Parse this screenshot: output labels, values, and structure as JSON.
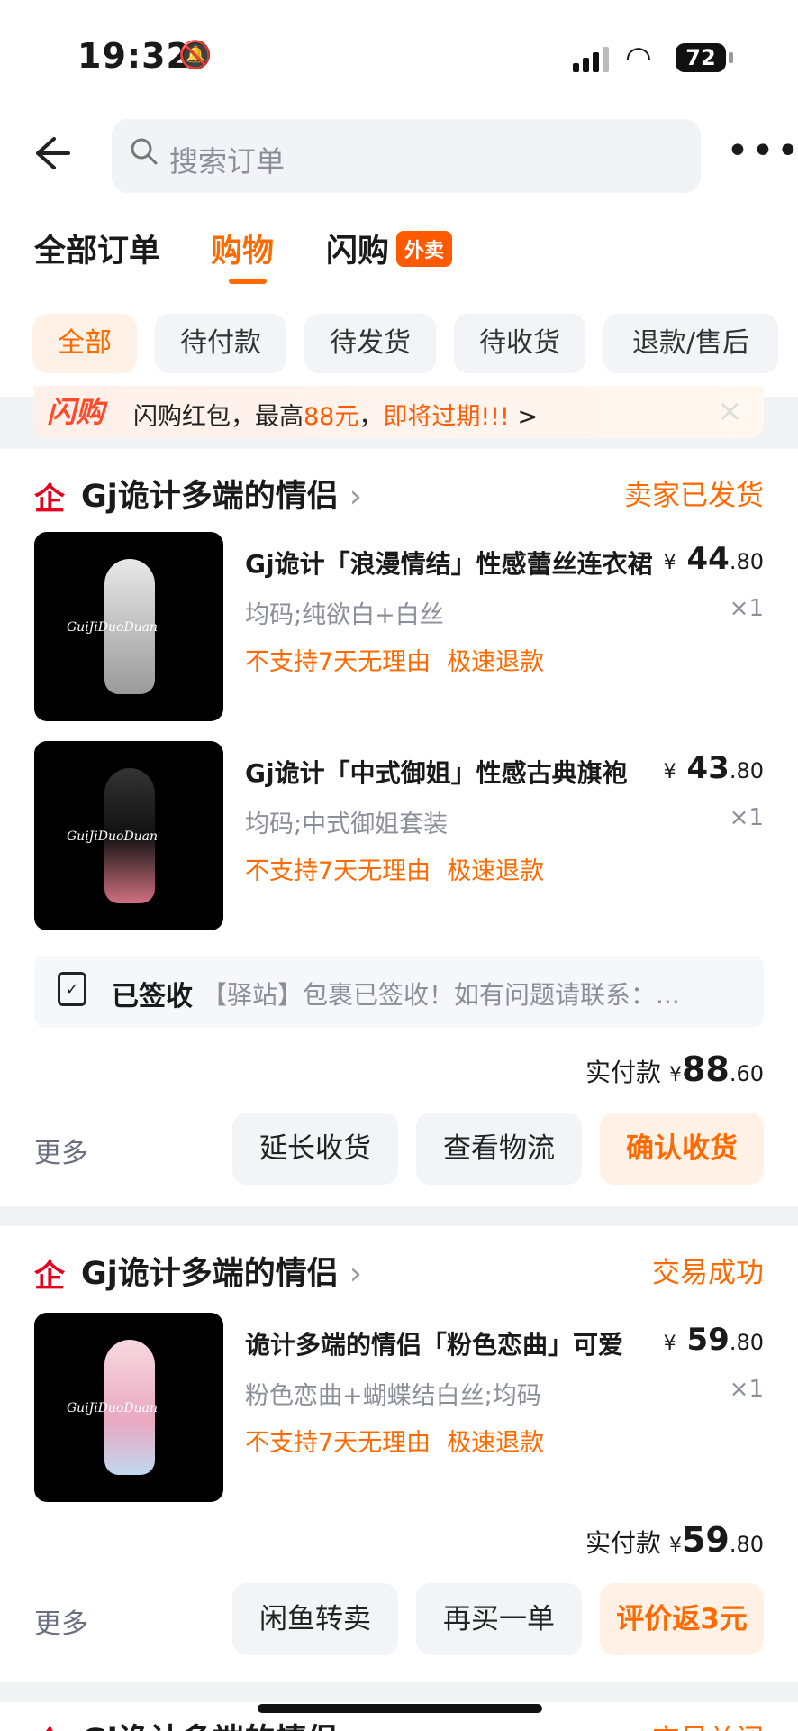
{
  "status_bar": {
    "time": "19:32",
    "battery": "72"
  },
  "header": {
    "search_placeholder": "搜索订单",
    "more": "•••"
  },
  "tabs": [
    {
      "label": "全部订单"
    },
    {
      "label": "购物"
    },
    {
      "label": "闪购",
      "tag": "外卖"
    }
  ],
  "filters": [
    "全部",
    "待付款",
    "待发货",
    "待收货",
    "退款/售后"
  ],
  "promo": {
    "logo": "闪购",
    "pre": "闪购红包，最高",
    "amount": "88元",
    "comma": "，",
    "expire": "即将过期!!!",
    "arrow": ">",
    "close": "×"
  },
  "orders": [
    {
      "shop": "Gj诡计多端的情侣",
      "status": "卖家已发货",
      "items": [
        {
          "title": "Gj诡计「浪漫情结」性感蕾丝连衣裙",
          "price_int": "44",
          "price_dec": ".80",
          "spec": "均码;纯欲白+白丝",
          "qty": "×1",
          "policy1": "不支持7天无理由",
          "policy2": "极速退款"
        },
        {
          "title": "Gj诡计「中式御姐」性感古典旗袍",
          "price_int": "43",
          "price_dec": ".80",
          "spec": "均码;中式御姐套装",
          "qty": "×1",
          "policy1": "不支持7天无理由",
          "policy2": "极速退款"
        }
      ],
      "sign": {
        "title": "已签收",
        "text": "【驿站】包裹已签收！如有问题请联系：..."
      },
      "paid_label": "实付款",
      "paid_int": "88",
      "paid_dec": ".60",
      "more": "更多",
      "buttons": [
        "延长收货",
        "查看物流",
        "确认收货"
      ]
    },
    {
      "shop": "Gj诡计多端的情侣",
      "status": "交易成功",
      "items": [
        {
          "title": "诡计多端的情侣「粉色恋曲」可爱",
          "price_int": "59",
          "price_dec": ".80",
          "spec": "粉色恋曲+蝴蝶结白丝;均码",
          "qty": "×1",
          "policy1": "不支持7天无理由",
          "policy2": "极速退款"
        }
      ],
      "paid_label": "实付款",
      "paid_int": "59",
      "paid_dec": ".80",
      "more": "更多",
      "buttons": [
        "闲鱼转卖",
        "再买一单",
        "评价返3元"
      ]
    },
    {
      "shop": "Gj诡计多端的情侣",
      "status": "交易关闭"
    }
  ],
  "thumb_watermark": "GuiJiDuoDuan",
  "currency": "¥",
  "shop_icon": "企",
  "colors": {
    "accent": "#ff6a00",
    "shop_icon": "#e6001e",
    "tag_bg": "#ff5a00"
  }
}
